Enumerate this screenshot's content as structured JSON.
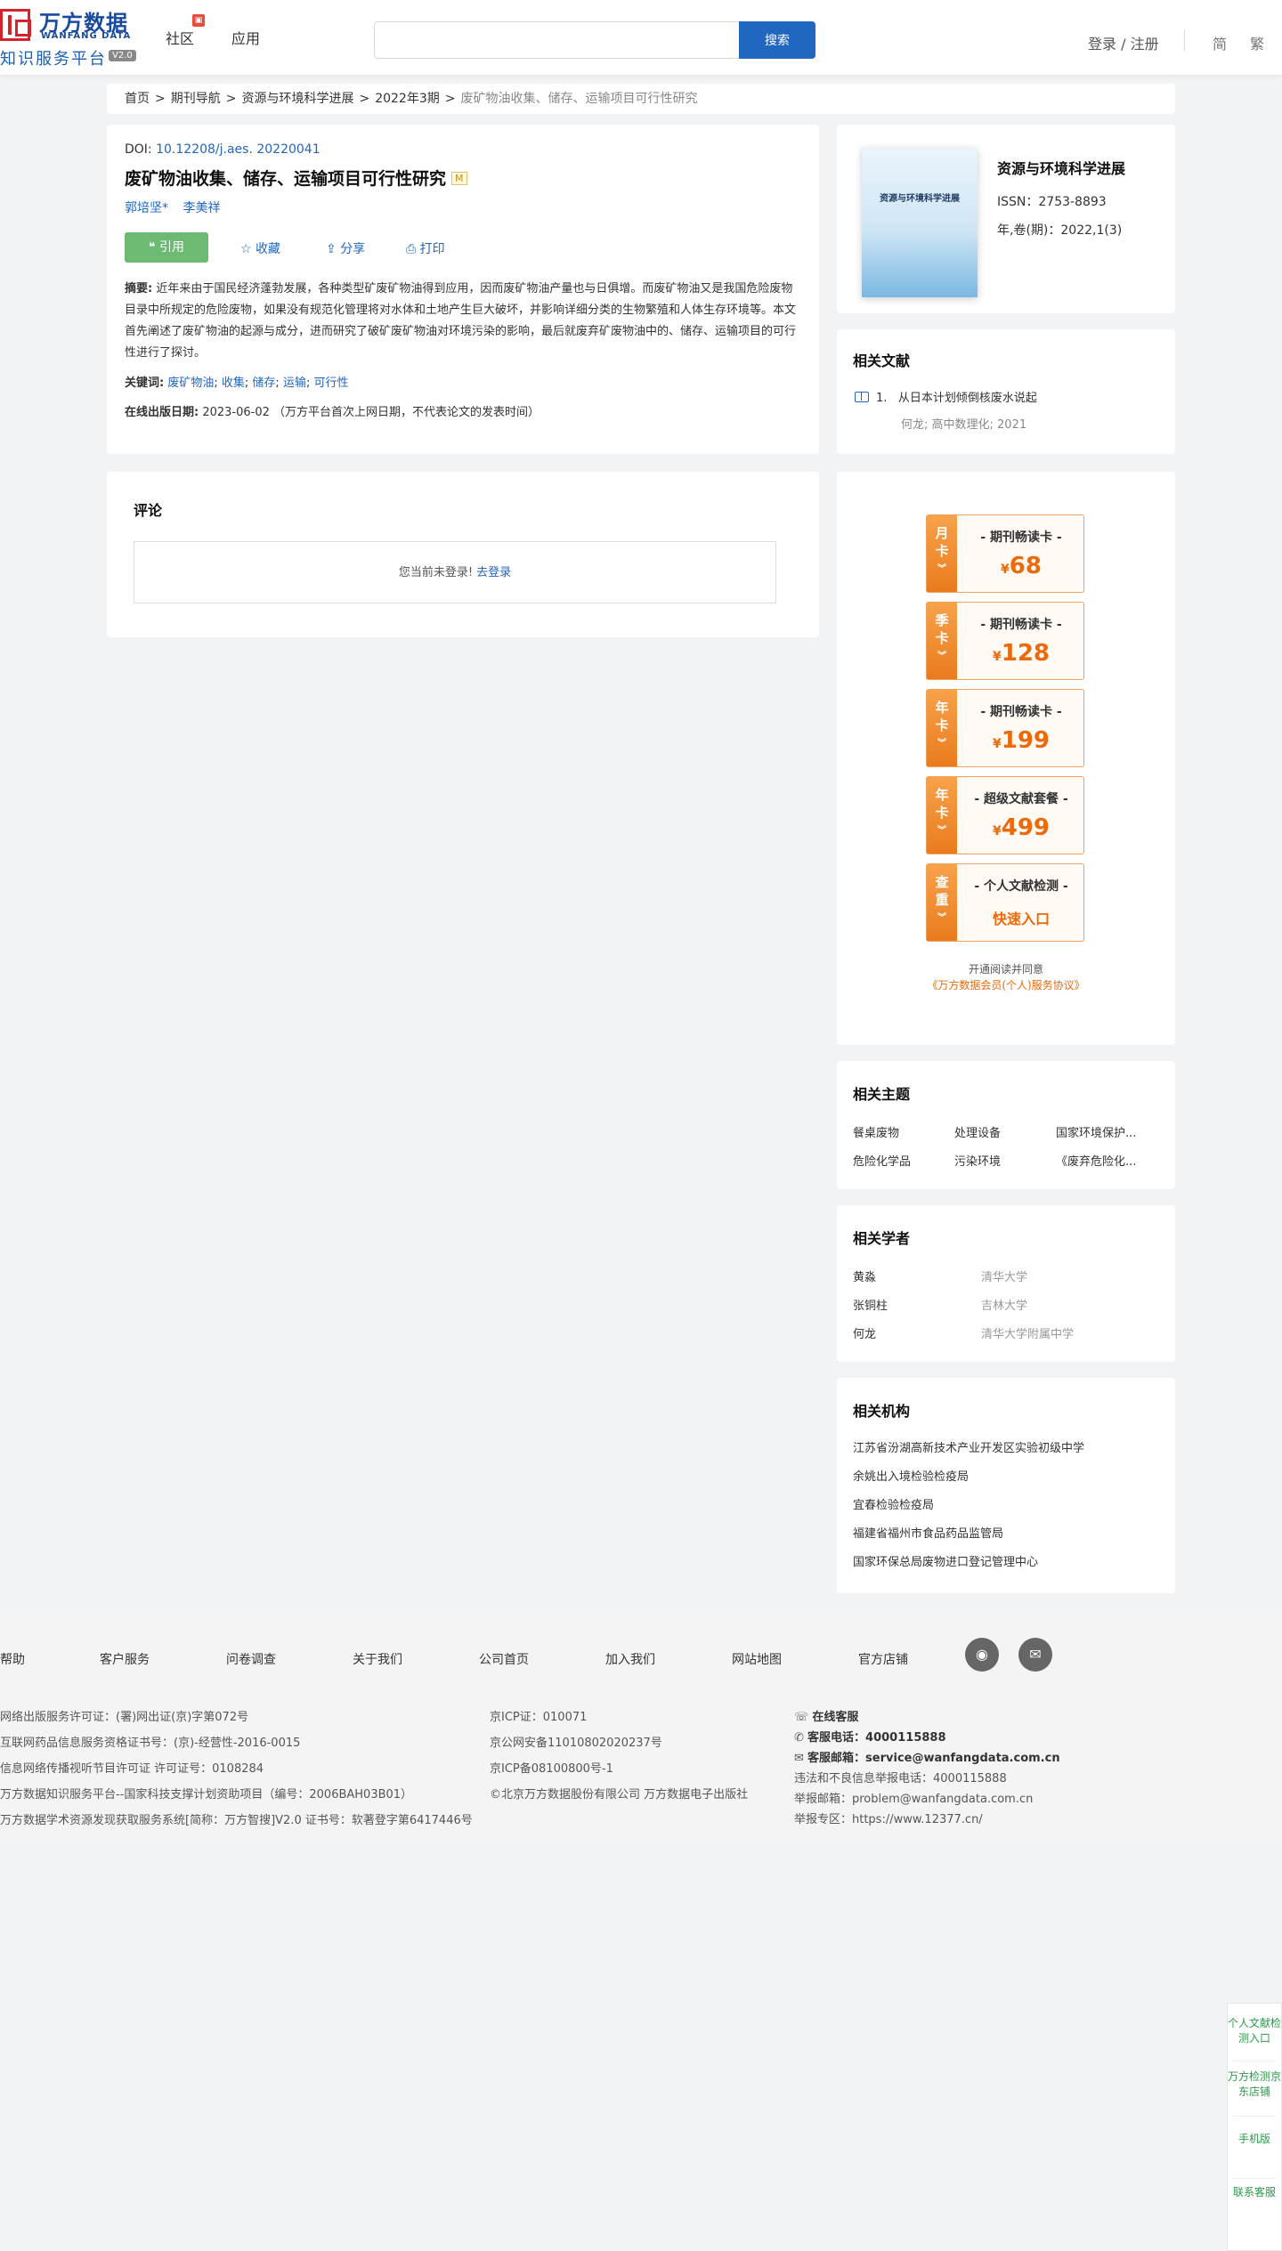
{
  "header": {
    "logo_cn": "万方数据",
    "logo_en": "WANFANG DATA",
    "logo_sub": "知识服务平台",
    "logo_ver": "V2.0",
    "nav": [
      "社区",
      "应用"
    ],
    "search_placeholder": "",
    "search_button": "搜索",
    "login": "登录 / 注册",
    "lang_simplified": "简",
    "lang_traditional": "繁"
  },
  "breadcrumb": [
    "首页",
    "期刊导航",
    "资源与环境科学进展",
    "2022年3期",
    "废矿物油收集、储存、运输项目可行性研究"
  ],
  "article": {
    "doi_label": "DOI:",
    "doi_value": "10.12208/j.aes. 20220041",
    "title": "废矿物油收集、储存、运输项目可行性研究",
    "badge": "M",
    "authors": [
      "郭培坚*",
      "李美祥"
    ],
    "actions": {
      "cite": "引用",
      "favorite": "收藏",
      "share": "分享",
      "print": "打印"
    },
    "abstract_label": "摘要:",
    "abstract": "近年来由于国民经济蓬勃发展，各种类型矿废矿物油得到应用，因而废矿物油产量也与日俱增。而废矿物油又是我国危险废物目录中所规定的危险废物，如果没有规范化管理将对水体和土地产生巨大破坏，并影响详细分类的生物繁殖和人体生存环境等。本文首先阐述了废矿物油的起源与成分，进而研究了破矿废矿物油对环境污染的影响，最后就废弃矿废物油中的、储存、运输项目的可行性进行了探讨。",
    "keywords_label": "关键词:",
    "keywords": [
      "废矿物油",
      "收集",
      "储存",
      "运输",
      "可行性"
    ],
    "pubdate_label": "在线出版日期:",
    "pubdate": "2023-06-02",
    "pubdate_note": "（万方平台首次上网日期，不代表论文的发表时间）"
  },
  "comments": {
    "title": "评论",
    "not_logged": "您当前未登录!",
    "login_link": "去登录"
  },
  "journal": {
    "cover_title": "资源与环境科学进展",
    "name": "资源与环境科学进展",
    "issn": "ISSN：2753-8893",
    "volume": "年,卷(期)：2022,1(3)"
  },
  "related_docs": {
    "title": "相关文献",
    "items": [
      {
        "num": "1.",
        "title": "从日本计划倾倒核废水说起",
        "meta": "何龙; 高中数理化; 2021"
      }
    ]
  },
  "membership": {
    "cards": [
      {
        "side": [
          "月",
          "卡"
        ],
        "name": "- 期刊畅读卡 -",
        "currency": "¥",
        "price": "68"
      },
      {
        "side": [
          "季",
          "卡"
        ],
        "name": "- 期刊畅读卡 -",
        "currency": "¥",
        "price": "128"
      },
      {
        "side": [
          "年",
          "卡"
        ],
        "name": "- 期刊畅读卡 -",
        "currency": "¥",
        "price": "199"
      },
      {
        "side": [
          "年",
          "卡"
        ],
        "name": "- 超级文献套餐 -",
        "currency": "¥",
        "price": "499"
      },
      {
        "side": [
          "查",
          "重"
        ],
        "name": "- 个人文献检测 -",
        "entry": "快速入口"
      }
    ],
    "agree_text": "开通阅读并同意",
    "agree_link": "《万方数据会员(个人)服务协议》"
  },
  "related_topics": {
    "title": "相关主题",
    "items": [
      "餐桌废物",
      "处理设备",
      "国家环境保护...",
      "危险化学品",
      "污染环境",
      "《废弃危险化..."
    ]
  },
  "related_scholars": {
    "title": "相关学者",
    "items": [
      {
        "name": "黄淼",
        "org": "清华大学"
      },
      {
        "name": "张铜柱",
        "org": "吉林大学"
      },
      {
        "name": "何龙",
        "org": "清华大学附属中学"
      }
    ]
  },
  "related_institutions": {
    "title": "相关机构",
    "items": [
      "江苏省汾湖高新技术产业开发区实验初级中学",
      "余姚出入境检验检疫局",
      "宜春检验检疫局",
      "福建省福州市食品药品监管局",
      "国家环保总局废物进口登记管理中心"
    ]
  },
  "footer": {
    "nav": [
      "帮助",
      "客户服务",
      "问卷调查",
      "关于我们",
      "公司首页",
      "加入我们",
      "网站地图",
      "官方店铺"
    ],
    "col1": [
      "网络出版服务许可证：(署)网出证(京)字第072号",
      "互联网药品信息服务资格证书号：(京)-经营性-2016-0015",
      "信息网络传播视听节目许可证 许可证号：0108284",
      "万方数据知识服务平台--国家科技支撑计划资助项目（编号：2006BAH03B01）",
      "万方数据学术资源发现获取服务系统[简称：万方智搜]V2.0 证书号：软著登字第6417446号"
    ],
    "col2": [
      "京ICP证：010071",
      "京公网安备11010802020237号",
      "京ICP备08100800号-1",
      "©北京万方数据股份有限公司 万方数据电子出版社"
    ],
    "online_service": "在线客服",
    "phone_label": "客服电话：",
    "phone": "4000115888",
    "email_label": "客服邮箱：",
    "email": "service@wanfangdata.com.cn",
    "col3": [
      "违法和不良信息举报电话：4000115888",
      "举报邮箱：problem@wanfangdata.com.cn",
      "举报专区：https://www.12377.cn/"
    ]
  },
  "float_bar": [
    "个人文献检测入口",
    "万方检测京东店铺",
    "手机版",
    "联系客服"
  ]
}
